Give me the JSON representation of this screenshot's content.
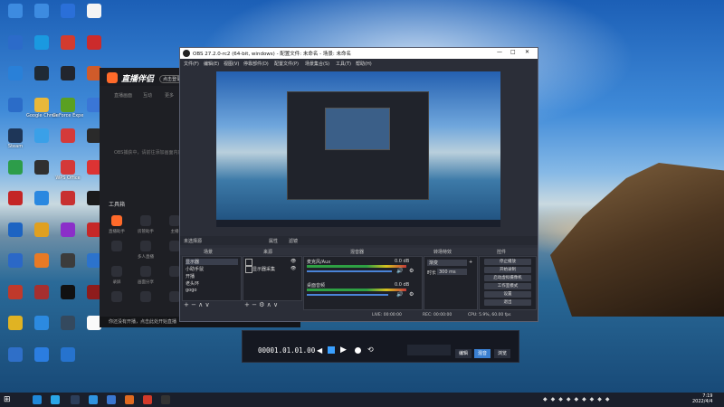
{
  "desktop_icons": [
    {
      "label": "",
      "color": "#3d8be0"
    },
    {
      "label": "",
      "color": "#3d8be0"
    },
    {
      "label": "",
      "color": "#2a6fd8"
    },
    {
      "label": "",
      "color": "#f4f4f4"
    },
    {
      "label": "",
      "color": "#2c6bc9"
    },
    {
      "label": "",
      "color": "#1a99e0"
    },
    {
      "label": "",
      "color": "#d33b2e"
    },
    {
      "label": "",
      "color": "#cc2b2b"
    },
    {
      "label": "",
      "color": "#2980d8"
    },
    {
      "label": "",
      "color": "#1f2a35"
    },
    {
      "label": "",
      "color": "#22252e"
    },
    {
      "label": "",
      "color": "#d05b2a"
    },
    {
      "label": "",
      "color": "#2b6cc8"
    },
    {
      "label": "Google Chrome",
      "color": "#e8b83a"
    },
    {
      "label": "GeForce Experience",
      "color": "#5aa022"
    },
    {
      "label": "",
      "color": "#3a76d6"
    },
    {
      "label": "Steam",
      "color": "#1e3658"
    },
    {
      "label": "",
      "color": "#3aa0e8"
    },
    {
      "label": "",
      "color": "#d43a3a"
    },
    {
      "label": "",
      "color": "#2a2a2a"
    },
    {
      "label": "",
      "color": "#2d9d4a"
    },
    {
      "label": "",
      "color": "#303030"
    },
    {
      "label": "WPS Office",
      "color": "#d43838"
    },
    {
      "label": "",
      "color": "#d33"
    },
    {
      "label": "",
      "color": "#c42525"
    },
    {
      "label": "",
      "color": "#2a88e0"
    },
    {
      "label": "",
      "color": "#c83030"
    },
    {
      "label": "",
      "color": "#1a1a1a"
    },
    {
      "label": "",
      "color": "#1d64c2"
    },
    {
      "label": "",
      "color": "#e0a020"
    },
    {
      "label": "",
      "color": "#8b2fc9"
    },
    {
      "label": "",
      "color": "#c62828"
    },
    {
      "label": "",
      "color": "#2b68c7"
    },
    {
      "label": "",
      "color": "#e87a25"
    },
    {
      "label": "",
      "color": "#3c3c3c"
    },
    {
      "label": "",
      "color": "#2c73cc"
    },
    {
      "label": "",
      "color": "#c0392b"
    },
    {
      "label": "",
      "color": "#a62f2f"
    },
    {
      "label": "",
      "color": "#111"
    },
    {
      "label": "",
      "color": "#8e1c1c"
    },
    {
      "label": "",
      "color": "#e0b323"
    },
    {
      "label": "",
      "color": "#2c8ae0"
    },
    {
      "label": "",
      "color": "#34495e"
    },
    {
      "label": "",
      "color": "#fafafa"
    },
    {
      "label": "",
      "color": "#2f6fc8"
    },
    {
      "label": "",
      "color": "#2b7de0"
    },
    {
      "label": "",
      "color": "#2673ce"
    }
  ],
  "zhibo": {
    "title": "直播伴侣",
    "login": "点击登录",
    "tabs": [
      "直播画面",
      "互动",
      "更多"
    ],
    "empty_hint": "OBS捕获中，请前往添加画面内容",
    "tools_title": "工具箱",
    "tools": [
      "直播助手",
      "房管助手",
      "主播",
      "",
      "多人直播",
      "",
      "录屏",
      "画面分享",
      "",
      "",
      "",
      ""
    ],
    "status": "你还没有开播，点击此处开始直播"
  },
  "obs": {
    "title": "OBS 27.2.0-rc2 (64-bit, windows) - 配置文件: 未命名 - 场景: 未命名",
    "window_controls": [
      "—",
      "□",
      "✕"
    ],
    "menu": [
      "文件(F)",
      "编辑(E)",
      "视图(V)",
      "停靠部件(D)",
      "配置文件(P)",
      "场景集合(S)",
      "工具(T)",
      "帮助(H)"
    ],
    "preview_toolbar": [
      "未选择源",
      "属性",
      "滤镜"
    ],
    "docks": {
      "scenes": {
        "title": "场景",
        "items": [
          "显示器",
          "小助手鼠",
          "开播",
          "老头环",
          "gogo"
        ]
      },
      "sources": {
        "title": "来源",
        "items": [
          "",
          "显示器采集"
        ]
      },
      "mixer": {
        "title": "混音器",
        "tracks": [
          {
            "name": "麦克风/Aux",
            "db": "0.0 dB",
            "level": 0.9
          },
          {
            "name": "桌面音频",
            "db": "0.0 dB",
            "level": 0.85
          }
        ]
      },
      "transitions": {
        "title": "转场特效",
        "type": "渐变",
        "duration_label": "时长",
        "duration": "300 ms"
      },
      "controls": {
        "title": "控件",
        "buttons": [
          "停止播放",
          "开始录制",
          "启动虚拟摄像机",
          "工作室模式",
          "设置",
          "退出"
        ]
      }
    },
    "status": {
      "live": "LIVE: 00:00:00",
      "rec": "REC: 00:00:00",
      "cpu": "CPU: 5.9%, 60.00 fps"
    }
  },
  "editor": {
    "timecode": "00001.01.01.00",
    "buttons": [
      "编辑",
      "混音",
      "浏览"
    ]
  },
  "taskbar": {
    "clock_time": "7:19",
    "clock_date": "2022/4/4"
  }
}
